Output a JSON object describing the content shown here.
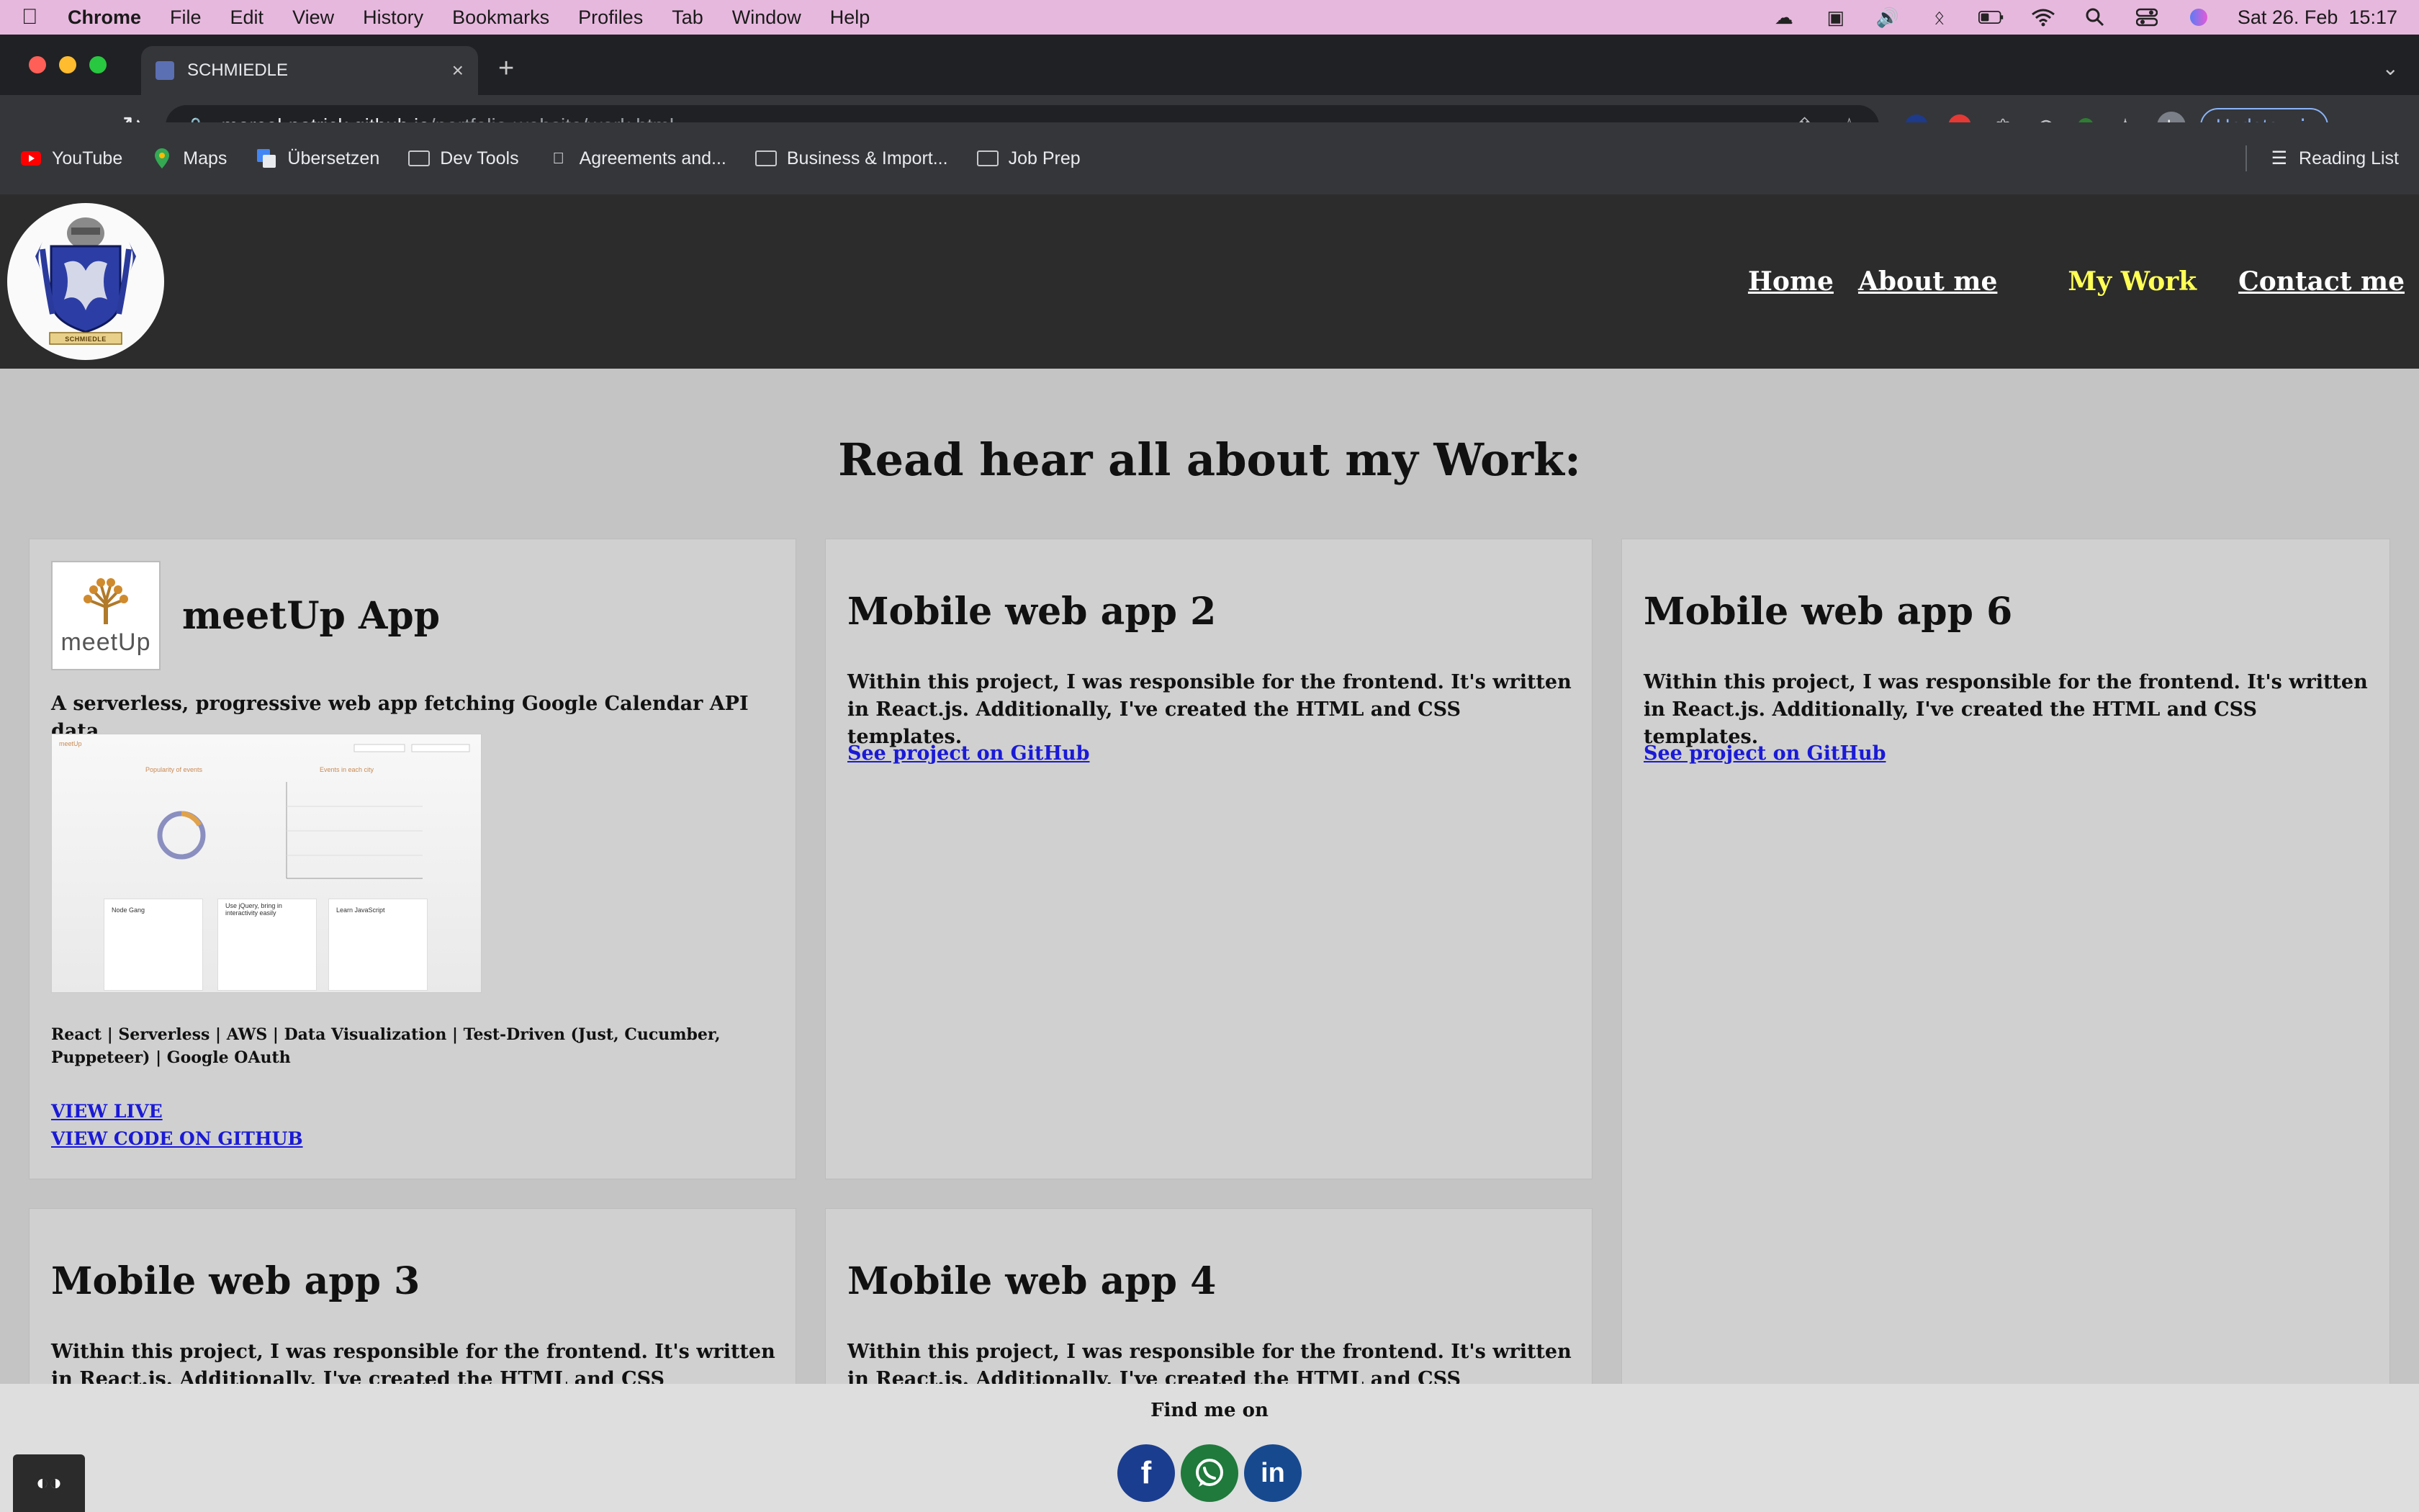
{
  "menubar": {
    "app": "Chrome",
    "items": [
      "File",
      "Edit",
      "View",
      "History",
      "Bookmarks",
      "Profiles",
      "Tab",
      "Window",
      "Help"
    ],
    "datetime": "Sat 26. Feb  15:17"
  },
  "browser": {
    "tab_title": "SCHMIEDLE",
    "url_host": "marcel-patrick.github.io",
    "url_path": "/portfolio-website/work.html",
    "update_label": "Update",
    "avatar_letter": "L",
    "bookmarks": [
      "YouTube",
      "Maps",
      "Übersetzen",
      "Dev Tools",
      "Agreements and...",
      "Business & Import...",
      "Job Prep"
    ],
    "reading_list": "Reading List"
  },
  "site": {
    "logo_text": "SCHMIEDLE",
    "nav": [
      "Home",
      "About me",
      "My Work",
      "Contact me"
    ],
    "active_nav": "My Work",
    "title": "Read hear all about my Work:",
    "cards": {
      "meetup": {
        "title": "meetUp App",
        "logo_word": "meetUp",
        "subtitle": "A serverless, progressive web app fetching Google Calendar API data",
        "tech": "React | Serverless | AWS | Data Visualization | Test-Driven (Just, Cucumber, Puppeteer) | Google OAuth",
        "link_live": "VIEW LIVE",
        "link_code": "VIEW CODE ON GITHUB",
        "shot": {
          "brand": "meetUp",
          "chart1": "Popularity of events",
          "chart2": "Events in each city",
          "events": [
            "Node Gang",
            "Use jQuery, bring in interactivity easily",
            "Learn JavaScript"
          ]
        }
      },
      "app2": {
        "title": "Mobile web app 2",
        "text": "Within this project, I was responsible for the frontend. It's written in React.js. Additionally, I've created the HTML and CSS templates.",
        "link": "See project on GitHub"
      },
      "app6": {
        "title": "Mobile web app 6",
        "text": "Within this project, I was responsible for the frontend. It's written in React.js. Additionally, I've created the HTML and CSS templates.",
        "link": "See project on GitHub"
      },
      "app3": {
        "title": "Mobile web app 3",
        "text": "Within this project, I was responsible for the frontend. It's written in React.js. Additionally, I've created the HTML and CSS templates."
      },
      "app4": {
        "title": "Mobile web app 4",
        "text": "Within this project, I was responsible for the frontend. It's written in React.js. Additionally, I've created the HTML and CSS templates."
      }
    },
    "footer": {
      "find": "Find me on",
      "socials": [
        "facebook-icon",
        "whatsapp-icon",
        "linkedin-icon"
      ]
    }
  },
  "colors": {
    "header_bg": "#2c2c2c",
    "nav_active": "#ffff55",
    "link": "#1a1ad6",
    "page_bg": "#c4c4c4",
    "card_bg": "#d0d0d0"
  }
}
